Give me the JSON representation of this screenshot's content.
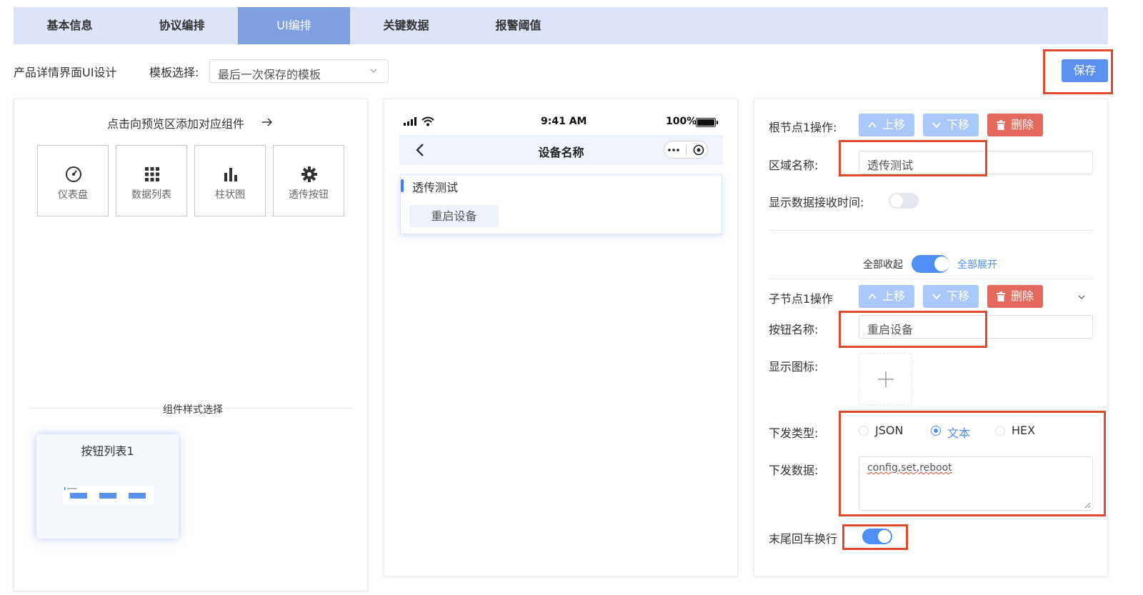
{
  "tabs": [
    {
      "label": "基本信息"
    },
    {
      "label": "协议编排"
    },
    {
      "label": "UI编排"
    },
    {
      "label": "关键数据"
    },
    {
      "label": "报警阈值"
    }
  ],
  "header": {
    "title": "产品详情界面UI设计",
    "template_label": "模板选择:",
    "template_value": "最后一次保存的模板",
    "save_label": "保存"
  },
  "components": {
    "hint": "点击向预览区添加对应组件",
    "items": [
      {
        "label": "仪表盘",
        "icon": "gauge-icon"
      },
      {
        "label": "数据列表",
        "icon": "grid-icon"
      },
      {
        "label": "柱状图",
        "icon": "bar-chart-icon"
      },
      {
        "label": "透传按钮",
        "icon": "gear-icon"
      }
    ],
    "style_section": "组件样式选择",
    "style_card_title": "按钮列表1"
  },
  "phone": {
    "time": "9:41 AM",
    "battery": "100%",
    "nav_title": "设备名称",
    "widget_title": "透传测试",
    "widget_button": "重启设备"
  },
  "root_node": {
    "label": "根节点1操作:",
    "up": "上移",
    "down": "下移",
    "delete": "删除",
    "area_name_label": "区域名称:",
    "area_name_value": "透传测试",
    "show_time_label": "显示数据接收时间:",
    "show_time_on": false
  },
  "expand": {
    "collapse_all": "全部收起",
    "expand_all": "全部展开",
    "on": true
  },
  "child_node": {
    "label": "子节点1操作",
    "up": "上移",
    "down": "下移",
    "delete": "删除",
    "button_name_label": "按钮名称:",
    "button_name_value": "重启设备",
    "icon_label": "显示图标:",
    "send_type_label": "下发类型:",
    "send_types": [
      "JSON",
      "文本",
      "HEX"
    ],
    "send_type_selected": "文本",
    "send_data_label": "下发数据:",
    "send_data_value": "config,set,reboot",
    "newline_label": "末尾回车换行",
    "newline_on": true
  },
  "colors": {
    "accent": "#4e8ef5",
    "tab_active": "#7fa0e0",
    "danger": "#e4695d",
    "highlight": "#e04a2f"
  }
}
